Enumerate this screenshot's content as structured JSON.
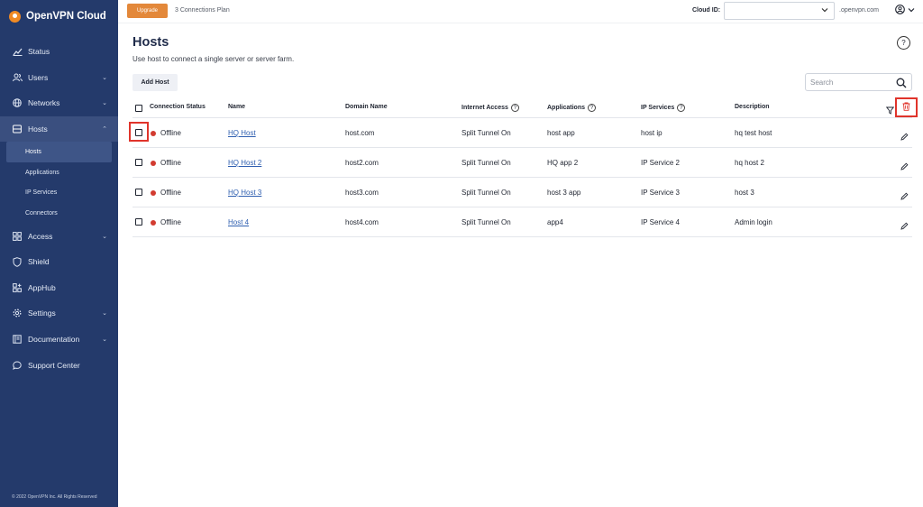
{
  "sidebar": {
    "brand": "OpenVPN Cloud",
    "items": [
      {
        "label": "Status",
        "icon": "chart-line-icon"
      },
      {
        "label": "Users",
        "icon": "users-icon",
        "chevron": "⌄"
      },
      {
        "label": "Networks",
        "icon": "globe-icon",
        "chevron": "⌄"
      },
      {
        "label": "Hosts",
        "icon": "server-icon",
        "chevron": "⌃"
      }
    ],
    "subitems": [
      "Hosts",
      "Applications",
      "IP Services",
      "Connectors"
    ],
    "items_after": [
      {
        "label": "Access",
        "icon": "grid-icon",
        "chevron": "⌄"
      },
      {
        "label": "Shield",
        "icon": "shield-icon"
      },
      {
        "label": "AppHub",
        "icon": "apphub-icon"
      },
      {
        "label": "Settings",
        "icon": "gear-icon",
        "chevron": "⌄"
      },
      {
        "label": "Documentation",
        "icon": "book-icon",
        "chevron": "⌄"
      },
      {
        "label": "Support Center",
        "icon": "chat-icon"
      }
    ],
    "footer": "© 2022 OpenVPN Inc. All Rights Reserved"
  },
  "topbar": {
    "upgrade_label": "Upgrade",
    "plan": "3 Connections Plan",
    "cloud_id_label": "Cloud ID:",
    "cloud_id_value": "",
    "domain_suffix": ".openvpn.com"
  },
  "main": {
    "title": "Hosts",
    "subtitle": "Use host to connect a single server or server farm.",
    "add_host_label": "Add Host",
    "search_placeholder": "Search"
  },
  "table": {
    "columns": [
      "Connection Status",
      "Name",
      "Domain Name",
      "Internet Access",
      "Applications",
      "IP Services",
      "Description"
    ],
    "rows": [
      {
        "status": "Offline",
        "name": "HQ Host",
        "domain": "host.com",
        "internet": "Split Tunnel On",
        "apps": "host app",
        "ip": "host ip",
        "desc": "hq test host"
      },
      {
        "status": "Offline",
        "name": "HQ Host 2",
        "domain": "host2.com",
        "internet": "Split Tunnel On",
        "apps": "HQ app 2",
        "ip": "IP Service 2",
        "desc": "hq host 2"
      },
      {
        "status": "Offline",
        "name": "HQ Host 3",
        "domain": "host3.com",
        "internet": "Split Tunnel On",
        "apps": "host 3 app",
        "ip": "IP Service 3",
        "desc": "host 3"
      },
      {
        "status": "Offline",
        "name": "Host 4",
        "domain": "host4.com",
        "internet": "Split Tunnel On",
        "apps": "app4",
        "ip": "IP Service 4",
        "desc": "Admin login"
      }
    ]
  },
  "colors": {
    "sidebar": "#243a6b",
    "accent": "#e3883a",
    "offline": "#d23b30",
    "highlight": "#e0342b",
    "link": "#2f5fb0"
  }
}
